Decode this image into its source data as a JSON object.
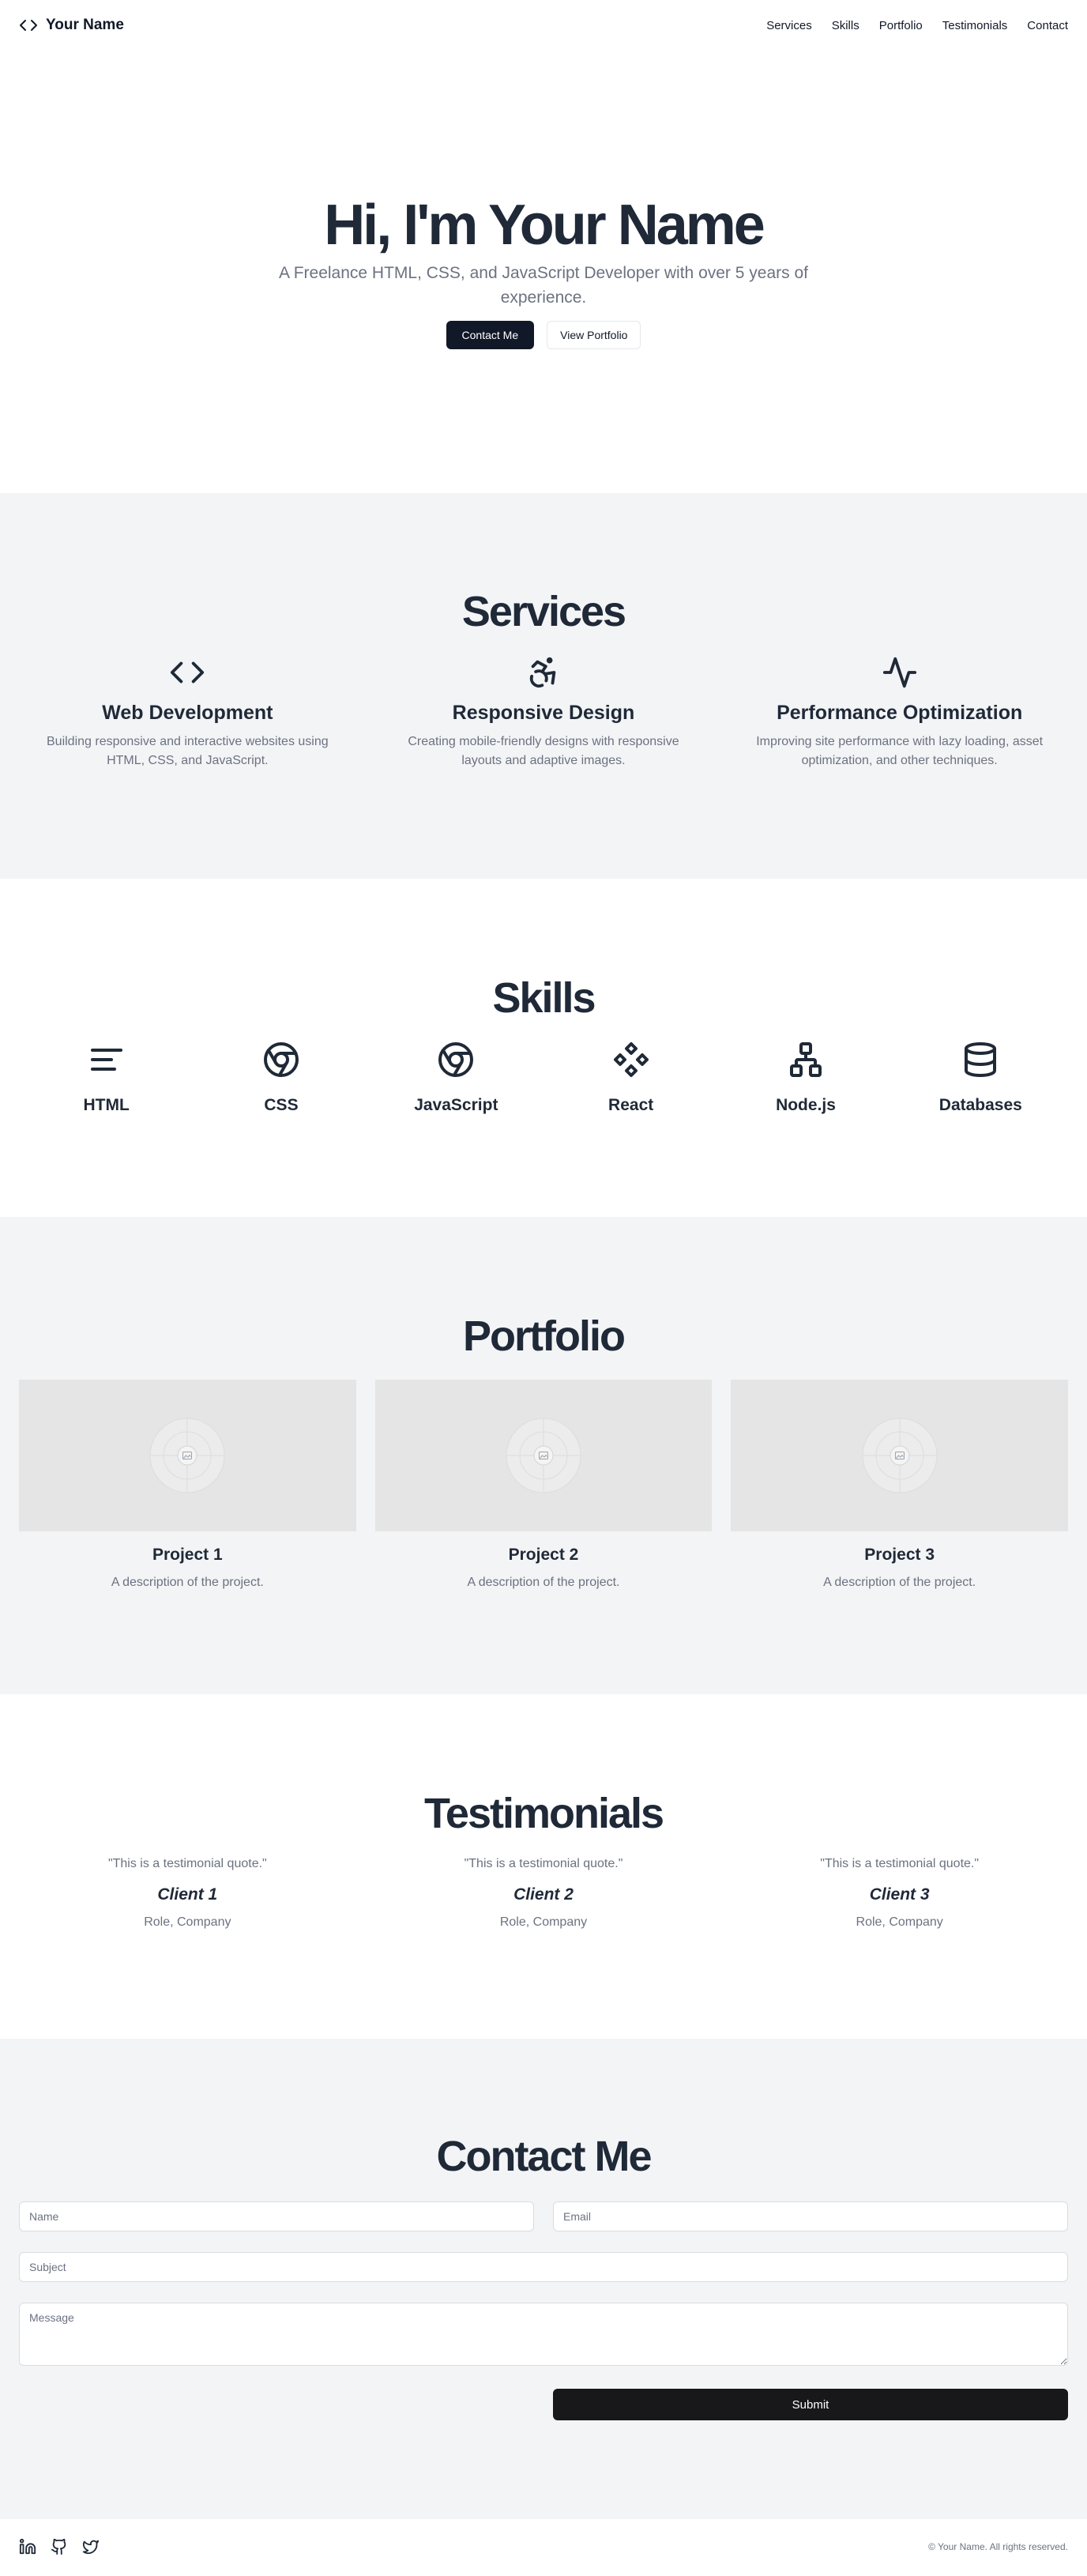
{
  "header": {
    "brand_icon": "code-icon",
    "brand_name": "Your Name",
    "nav": [
      "Services",
      "Skills",
      "Portfolio",
      "Testimonials",
      "Contact"
    ]
  },
  "hero": {
    "title": "Hi, I'm Your Name",
    "subtitle": "A Freelance HTML, CSS, and JavaScript Developer with over 5 years of experience.",
    "primary_button": "Contact Me",
    "secondary_button": "View Portfolio"
  },
  "services": {
    "title": "Services",
    "items": [
      {
        "icon": "code-icon",
        "title": "Web Development",
        "description": "Building responsive and interactive websites using HTML, CSS, and JavaScript."
      },
      {
        "icon": "accessibility-icon",
        "title": "Responsive Design",
        "description": "Creating mobile-friendly designs with responsive layouts and adaptive images."
      },
      {
        "icon": "activity-icon",
        "title": "Performance Optimization",
        "description": "Improving site performance with lazy loading, asset optimization, and other techniques."
      }
    ]
  },
  "skills": {
    "title": "Skills",
    "items": [
      {
        "icon": "text-align-icon",
        "name": "HTML"
      },
      {
        "icon": "chrome-icon",
        "name": "CSS"
      },
      {
        "icon": "chrome-icon",
        "name": "JavaScript"
      },
      {
        "icon": "diamond-grid-icon",
        "name": "React"
      },
      {
        "icon": "network-icon",
        "name": "Node.js"
      },
      {
        "icon": "database-icon",
        "name": "Databases"
      }
    ]
  },
  "portfolio": {
    "title": "Portfolio",
    "projects": [
      {
        "title": "Project 1",
        "description": "A description of the project."
      },
      {
        "title": "Project 2",
        "description": "A description of the project."
      },
      {
        "title": "Project 3",
        "description": "A description of the project."
      }
    ]
  },
  "testimonials": {
    "title": "Testimonials",
    "items": [
      {
        "quote": "\"This is a testimonial quote.\"",
        "client": "Client 1",
        "role": "Role, Company"
      },
      {
        "quote": "\"This is a testimonial quote.\"",
        "client": "Client 2",
        "role": "Role, Company"
      },
      {
        "quote": "\"This is a testimonial quote.\"",
        "client": "Client 3",
        "role": "Role, Company"
      }
    ]
  },
  "contact": {
    "title": "Contact Me",
    "name_placeholder": "Name",
    "email_placeholder": "Email",
    "subject_placeholder": "Subject",
    "message_placeholder": "Message",
    "submit_label": "Submit"
  },
  "footer": {
    "social_icons": [
      "linkedin-icon",
      "github-icon",
      "twitter-icon"
    ],
    "copyright": "© Your Name. All rights reserved."
  },
  "colors": {
    "text_dark": "#1f2937",
    "text_muted": "#6b7280",
    "section_alt_bg": "#f3f4f6",
    "button_dark": "#111827"
  }
}
